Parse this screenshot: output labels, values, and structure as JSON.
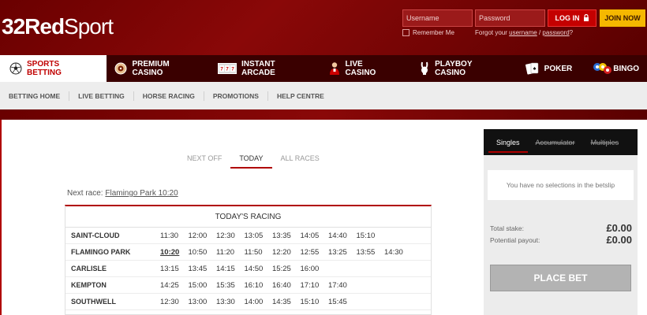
{
  "brand": {
    "logo_bold": "32Red",
    "logo_light": "Sport"
  },
  "login": {
    "username_placeholder": "Username",
    "password_placeholder": "Password",
    "login_label": "LOG IN",
    "join_label": "JOIN NOW",
    "remember_label": "Remember Me",
    "forgot_prefix": "Forgot your",
    "forgot_username": "username",
    "forgot_sep": "/",
    "forgot_password": "password",
    "forgot_suffix": "?"
  },
  "main_nav": [
    {
      "label": "SPORTS BETTING",
      "icon": "soccer-ball-icon"
    },
    {
      "label": "PREMIUM CASINO",
      "icon": "roulette-icon"
    },
    {
      "label": "INSTANT ARCADE",
      "icon": "slot-machine-icon"
    },
    {
      "label": "LIVE CASINO",
      "icon": "dealer-icon"
    },
    {
      "label": "PLAYBOY CASINO",
      "icon": "bunny-icon"
    },
    {
      "label": "POKER",
      "icon": "cards-icon"
    },
    {
      "label": "BINGO",
      "icon": "bingo-balls-icon"
    }
  ],
  "sub_nav": [
    "BETTING HOME",
    "LIVE BETTING",
    "HORSE RACING",
    "PROMOTIONS",
    "HELP CENTRE"
  ],
  "racing": {
    "tabs": [
      "NEXT OFF",
      "TODAY",
      "ALL RACES"
    ],
    "next_race_prefix": "Next race:",
    "next_race_link": "Flamingo Park 10:20",
    "title": "TODAY'S RACING",
    "rows": [
      {
        "track": "SAINT-CLOUD",
        "times": [
          "11:30",
          "12:00",
          "12:30",
          "13:05",
          "13:35",
          "14:05",
          "14:40",
          "15:10"
        ]
      },
      {
        "track": "FLAMINGO PARK",
        "times": [
          "10:20",
          "10:50",
          "11:20",
          "11:50",
          "12:20",
          "12:55",
          "13:25",
          "13:55",
          "14:30"
        ]
      },
      {
        "track": "CARLISLE",
        "times": [
          "13:15",
          "13:45",
          "14:15",
          "14:50",
          "15:25",
          "16:00"
        ]
      },
      {
        "track": "KEMPTON",
        "times": [
          "14:25",
          "15:00",
          "15:35",
          "16:10",
          "16:40",
          "17:10",
          "17:40"
        ]
      },
      {
        "track": "SOUTHWELL",
        "times": [
          "12:30",
          "13:00",
          "13:30",
          "14:00",
          "14:35",
          "15:10",
          "15:45"
        ]
      }
    ]
  },
  "betslip": {
    "tabs": [
      "Singles",
      "Accumulator",
      "Multiples"
    ],
    "empty_message": "You have no selections in the betslip",
    "total_stake_label": "Total stake:",
    "total_stake_value": "£0.00",
    "payout_label": "Potential payout:",
    "payout_value": "£0.00",
    "place_bet_label": "PLACE BET"
  }
}
